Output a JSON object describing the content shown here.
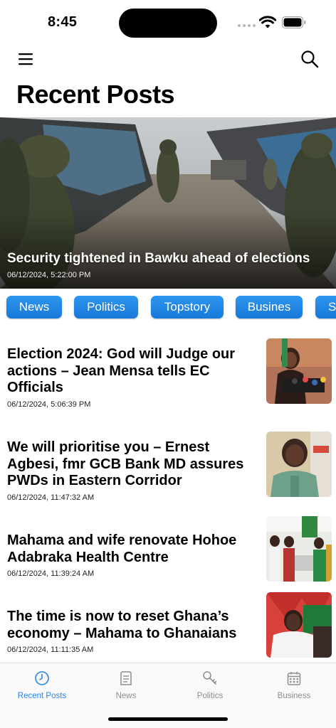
{
  "status_bar": {
    "time": "8:45"
  },
  "header": {
    "title": "Recent Posts"
  },
  "hero": {
    "title": "Security tightened in Bawku ahead of elections",
    "date": "06/12/2024, 5:22:00 PM"
  },
  "categories": [
    "News",
    "Politics",
    "Topstory",
    "Busines",
    "S"
  ],
  "posts": [
    {
      "title": "Election 2024: God will Judge our actions – Jean Mensa tells EC Officials",
      "date": "06/12/2024, 5:06:39 PM"
    },
    {
      "title": "We will prioritise you – Ernest Agbesi, fmr GCB Bank MD assures PWDs in Eastern Corridor",
      "date": "06/12/2024, 11:47:32 AM"
    },
    {
      "title": "Mahama and wife renovate Hohoe Adabraka Health Centre",
      "date": "06/12/2024, 11:39:24 AM"
    },
    {
      "title": "The time is now to reset Ghana’s economy – Mahama to Ghanaians",
      "date": "06/12/2024, 11:11:35 AM"
    }
  ],
  "tabs": [
    {
      "label": "Recent Posts",
      "icon": "clock-icon",
      "active": true
    },
    {
      "label": "News",
      "icon": "newspaper-icon",
      "active": false
    },
    {
      "label": "Politics",
      "icon": "key-icon",
      "active": false
    },
    {
      "label": "Business",
      "icon": "calendar-icon",
      "active": false
    }
  ],
  "colors": {
    "accent": "#2a86e8",
    "chip": "#1f86e6",
    "inactive_tab": "#8e8e93"
  }
}
